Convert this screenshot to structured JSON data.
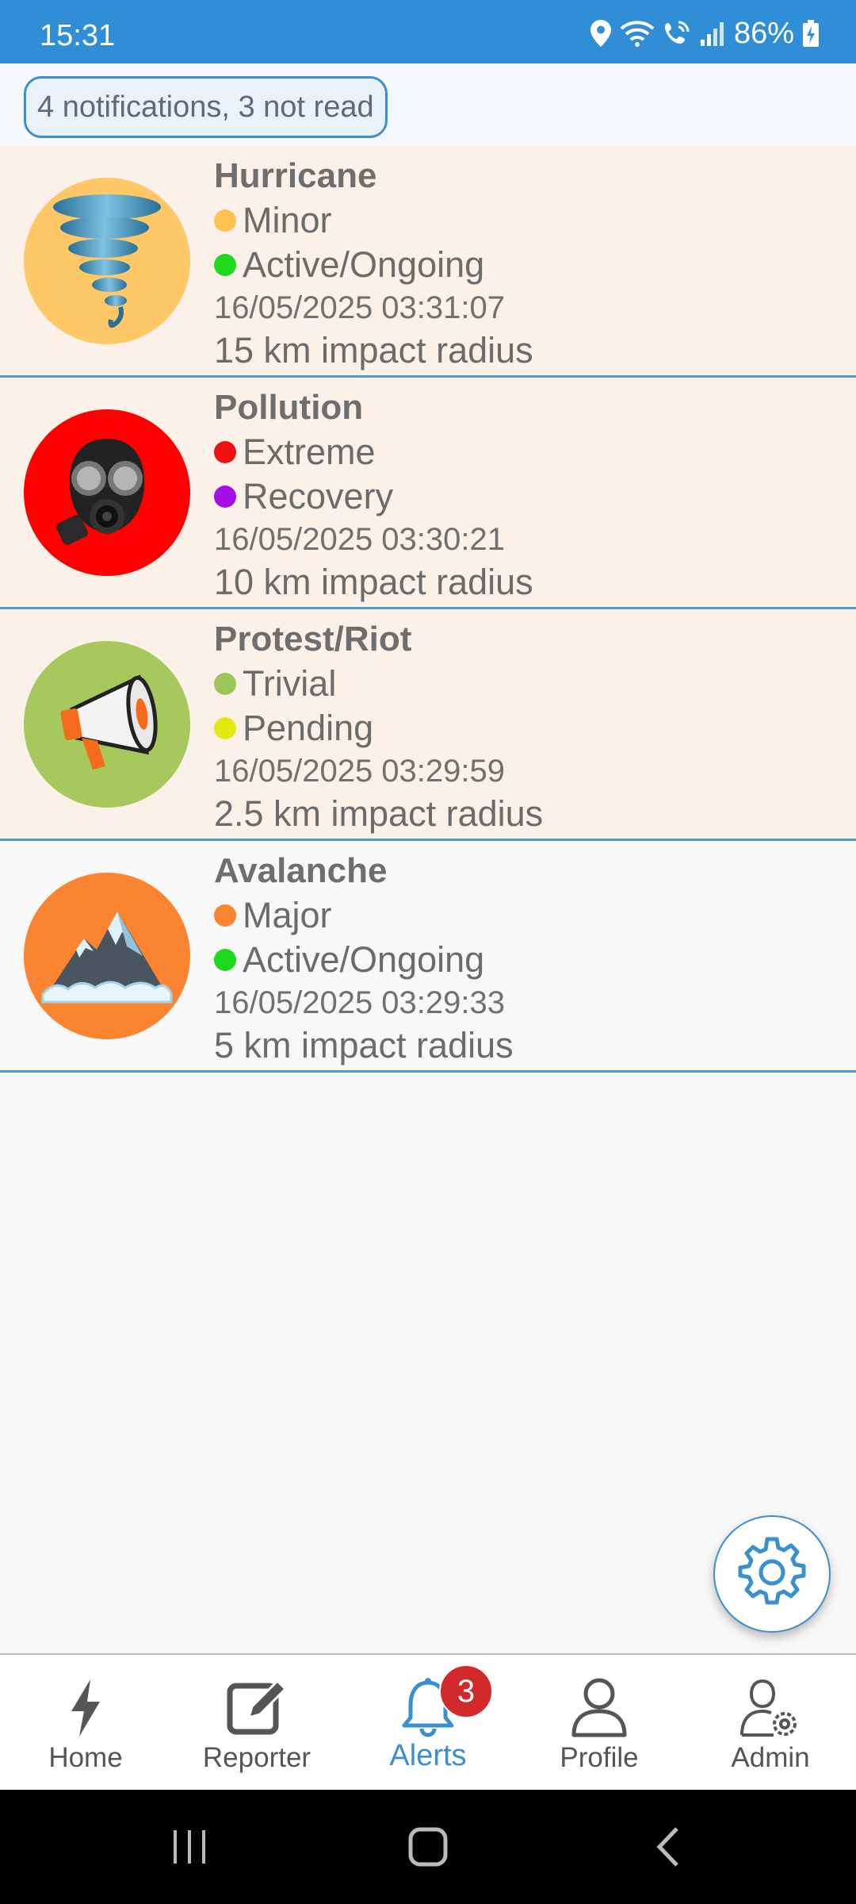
{
  "status_bar": {
    "time": "15:31",
    "battery": "86%",
    "icons": [
      "location-icon",
      "wifi-icon",
      "wifi-call-icon",
      "signal-icon",
      "battery-charging-icon"
    ]
  },
  "header": {
    "notifications_summary": "4 notifications, 3 not read"
  },
  "alerts": [
    {
      "title": "Hurricane",
      "icon": "tornado-icon",
      "icon_bg": "#ffc766",
      "severity": "Minor",
      "severity_color": "#ffc04d",
      "status": "Active/Ongoing",
      "status_color": "#1ed81e",
      "timestamp": "16/05/2025 03:31:07",
      "radius": "15 km impact radius",
      "read": false
    },
    {
      "title": "Pollution",
      "icon": "gas-mask-icon",
      "icon_bg": "#ff0000",
      "severity": "Extreme",
      "severity_color": "#ee1111",
      "status": "Recovery",
      "status_color": "#a40fe6",
      "timestamp": "16/05/2025 03:30:21",
      "radius": "10 km impact radius",
      "read": false
    },
    {
      "title": "Protest/Riot",
      "icon": "megaphone-icon",
      "icon_bg": "#a7c85c",
      "severity": "Trivial",
      "severity_color": "#9cc55a",
      "status": "Pending",
      "status_color": "#e3e811",
      "timestamp": "16/05/2025 03:29:59",
      "radius": "2.5 km impact radius",
      "read": false
    },
    {
      "title": "Avalanche",
      "icon": "snowy-mountain-icon",
      "icon_bg": "#fb8430",
      "severity": "Major",
      "severity_color": "#fb8430",
      "status": "Active/Ongoing",
      "status_color": "#1ed81e",
      "timestamp": "16/05/2025 03:29:33",
      "radius": "5 km impact radius",
      "read": true
    }
  ],
  "fab": {
    "icon": "gear-icon"
  },
  "bottom_nav": {
    "items": [
      {
        "label": "Home",
        "icon": "lightning-icon",
        "active": false
      },
      {
        "label": "Reporter",
        "icon": "edit-icon",
        "active": false
      },
      {
        "label": "Alerts",
        "icon": "bell-icon",
        "active": true,
        "badge": "3"
      },
      {
        "label": "Profile",
        "icon": "user-icon",
        "active": false
      },
      {
        "label": "Admin",
        "icon": "admin-icon",
        "active": false
      }
    ]
  },
  "colors": {
    "accent": "#2f8ed6",
    "divider": "#4a9ad8",
    "unread_bg": "#fcf1e8",
    "badge": "#d22a2a"
  }
}
